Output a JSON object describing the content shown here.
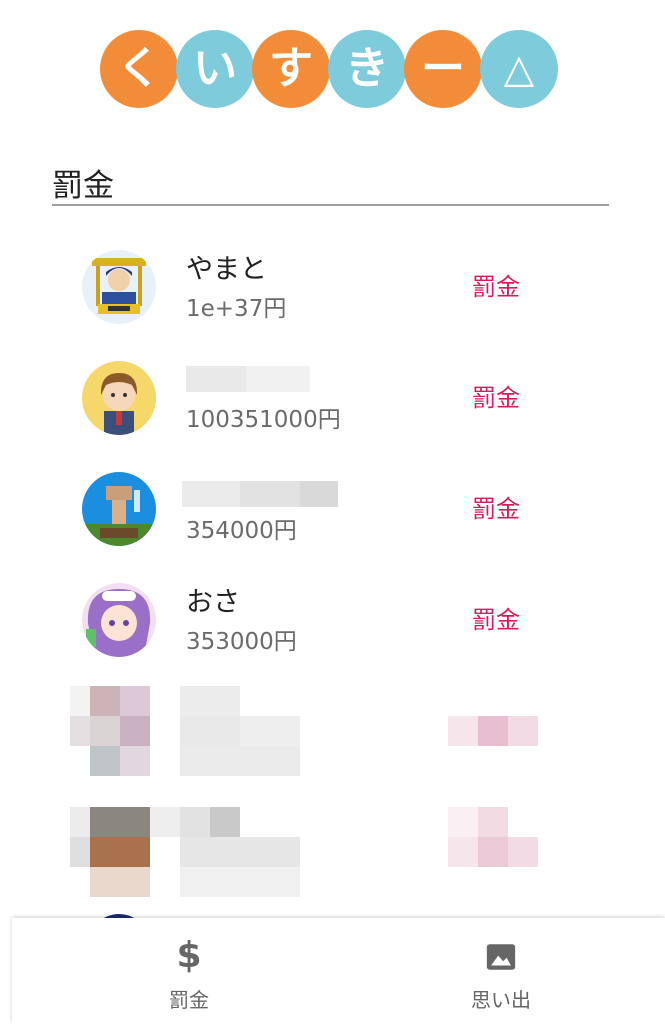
{
  "app": {
    "logo_chars": [
      "く",
      "い",
      "す",
      "き",
      "ー",
      "△"
    ],
    "logo_colors": [
      "#f28c38",
      "#7ecbdc",
      "#f28c38",
      "#7ecbdc",
      "#f28c38",
      "#7ecbdc"
    ]
  },
  "section": {
    "title": "罰金"
  },
  "players": [
    {
      "name": "やまと",
      "amount": "1e+37円",
      "action": "罰金"
    },
    {
      "name": "",
      "amount": "100351000円",
      "action": "罰金"
    },
    {
      "name": "",
      "amount": "354000円",
      "action": "罰金"
    },
    {
      "name": "おさ",
      "amount": "353000円",
      "action": "罰金"
    }
  ],
  "bottom_nav": {
    "items": [
      {
        "icon": "dollar-icon",
        "glyph": "$",
        "label": "罰金"
      },
      {
        "icon": "image-icon",
        "glyph": "",
        "label": "思い出"
      }
    ]
  },
  "colors": {
    "accent": "#d81b60",
    "orange": "#f28c38",
    "teal": "#7ecbdc"
  }
}
